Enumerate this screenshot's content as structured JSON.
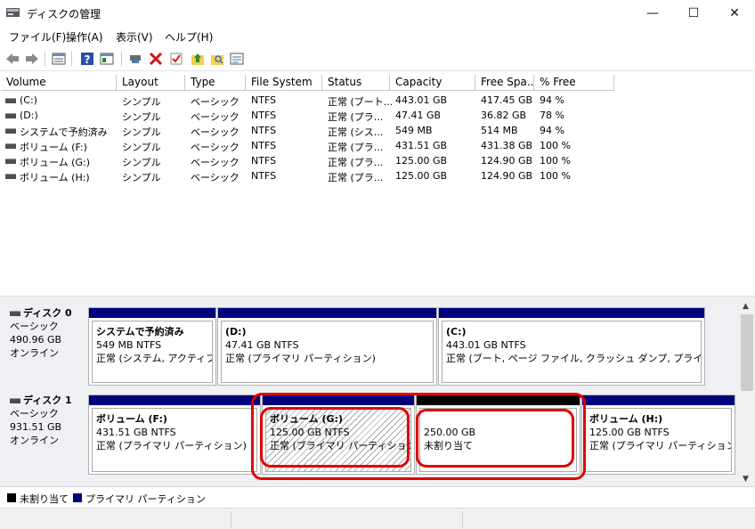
{
  "window": {
    "title": "ディスクの管理",
    "minimize": "—",
    "maximize": "☐",
    "close": "✕"
  },
  "menu": [
    "ファイル(F)",
    "操作(A)",
    "表示(V)",
    "ヘルプ(H)"
  ],
  "toolbar": [
    "back-icon",
    "forward-icon",
    "list-view-icon",
    "help-icon",
    "properties-icon",
    "connect-icon",
    "delete-icon",
    "check-icon",
    "folder-up-icon",
    "folder-search-icon",
    "details-icon"
  ],
  "volume_list": {
    "columns": [
      "Volume",
      "Layout",
      "Type",
      "File System",
      "Status",
      "Capacity",
      "Free Spa...",
      "% Free"
    ],
    "rows": [
      [
        "(C:)",
        "シンプル",
        "ベーシック",
        "NTFS",
        "正常 (ブート...",
        "443.01 GB",
        "417.45 GB",
        "94 %"
      ],
      [
        "(D:)",
        "シンプル",
        "ベーシック",
        "NTFS",
        "正常 (プラ...",
        "47.41 GB",
        "36.82 GB",
        "78 %"
      ],
      [
        "システムで予約済み",
        "シンプル",
        "ベーシック",
        "NTFS",
        "正常 (シス...",
        "549 MB",
        "514 MB",
        "94 %"
      ],
      [
        "ボリューム (F:)",
        "シンプル",
        "ベーシック",
        "NTFS",
        "正常 (プラ...",
        "431.51 GB",
        "431.38 GB",
        "100 %"
      ],
      [
        "ボリューム (G:)",
        "シンプル",
        "ベーシック",
        "NTFS",
        "正常 (プラ...",
        "125.00 GB",
        "124.90 GB",
        "100 %"
      ],
      [
        "ボリューム (H:)",
        "シンプル",
        "ベーシック",
        "NTFS",
        "正常 (プラ...",
        "125.00 GB",
        "124.90 GB",
        "100 %"
      ]
    ]
  },
  "disks": [
    {
      "name": "ディスク 0",
      "type": "ベーシック",
      "size": "490.96 GB",
      "state": "オンライン",
      "partitions": [
        {
          "title": "システムで予約済み",
          "size": "549 MB NTFS",
          "status": "正常 (システム, アクティブ, プ",
          "bar": "primary"
        },
        {
          "title": "(D:)",
          "size": "47.41 GB NTFS",
          "status": "正常 (プライマリ パーティション)",
          "bar": "primary"
        },
        {
          "title": "(C:)",
          "size": "443.01 GB NTFS",
          "status": "正常 (ブート, ページ ファイル, クラッシュ ダンプ, プライマリ パーテ",
          "bar": "primary"
        }
      ]
    },
    {
      "name": "ディスク 1",
      "type": "ベーシック",
      "size": "931.51 GB",
      "state": "オンライン",
      "partitions": [
        {
          "title": "ボリューム (F:)",
          "size": "431.51 GB NTFS",
          "status": "正常 (プライマリ パーティション)",
          "bar": "primary"
        },
        {
          "title": "ボリューム (G:)",
          "size": "125.00 GB NTFS",
          "status": "正常 (プライマリ パーティション)",
          "bar": "primary",
          "selected": true
        },
        {
          "title": "",
          "size": "250.00 GB",
          "status": "未割り当て",
          "bar": "unallocated"
        },
        {
          "title": "ボリューム (H:)",
          "size": "125.00 GB NTFS",
          "status": "正常 (プライマリ パーティション)",
          "bar": "primary"
        }
      ]
    }
  ],
  "legend": [
    {
      "label": "未割り当て",
      "color": "#000000"
    },
    {
      "label": "プライマリ パーティション",
      "color": "#00007f"
    }
  ],
  "colors": {
    "primary_partition": "#00007f",
    "unallocated": "#000000",
    "highlight": "#e30000"
  }
}
